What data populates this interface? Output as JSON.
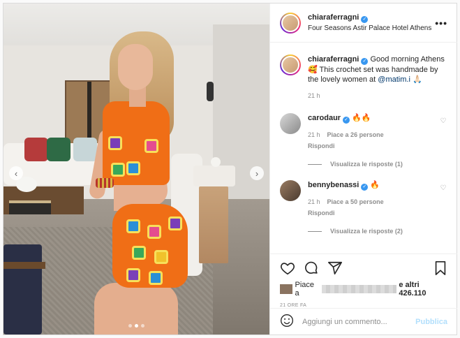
{
  "post": {
    "username": "chiaraferragni",
    "location": "Four Seasons Astir Palace Hotel Athens",
    "more_label": "•••"
  },
  "caption": {
    "username": "chiaraferragni",
    "text": "Good morning Athens 🥰 This crochet set was handmade by the lovely women at",
    "mention": "@matim.i",
    "emoji": "🙏🏻",
    "time": "21 h"
  },
  "comments": [
    {
      "username": "carodaur",
      "text": "🔥🔥",
      "time": "21 h",
      "likes": "Piace a 26 persone",
      "reply": "Rispondi",
      "view_replies": "Visualizza le risposte (1)"
    },
    {
      "username": "bennybenassi",
      "text": "🔥",
      "time": "21 h",
      "likes": "Piace a 50 persone",
      "reply": "Rispondi",
      "view_replies": "Visualizza le risposte (2)"
    }
  ],
  "likes": {
    "prefix": "Piace a",
    "suffix": "e altri 426.110"
  },
  "timestamp": "21 ORE FA",
  "add_comment": {
    "placeholder": "Aggiungi un commento...",
    "publish": "Pubblica"
  },
  "carousel": {
    "count": 3,
    "active": 2
  },
  "icons": [
    "heart-icon",
    "comment-icon",
    "share-icon",
    "bookmark-icon",
    "emoji-icon",
    "verified-badge-icon",
    "chevron-left-icon",
    "chevron-right-icon"
  ],
  "colors": {
    "accent": "#3897f0",
    "publish": "#b2dffc",
    "muted": "#8e8e8e"
  }
}
